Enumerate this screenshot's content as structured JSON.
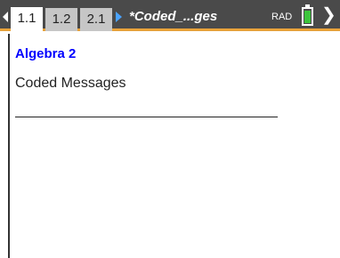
{
  "tabs": [
    {
      "label": "1.1",
      "active": true
    },
    {
      "label": "1.2",
      "active": false
    },
    {
      "label": "2.1",
      "active": false
    }
  ],
  "document_title": "*Coded_...ges",
  "angle_mode": "RAD",
  "battery_level": 0.9,
  "colors": {
    "tabbar_bg": "#4a4a4a",
    "accent": "#e8a23a",
    "heading": "#0000ff",
    "battery": "#3cc43c"
  },
  "page": {
    "heading": "Algebra 2",
    "subtitle": "Coded Messages"
  },
  "icons": [
    "nav-left-icon",
    "nav-right-icon",
    "battery-icon",
    "close-icon"
  ]
}
